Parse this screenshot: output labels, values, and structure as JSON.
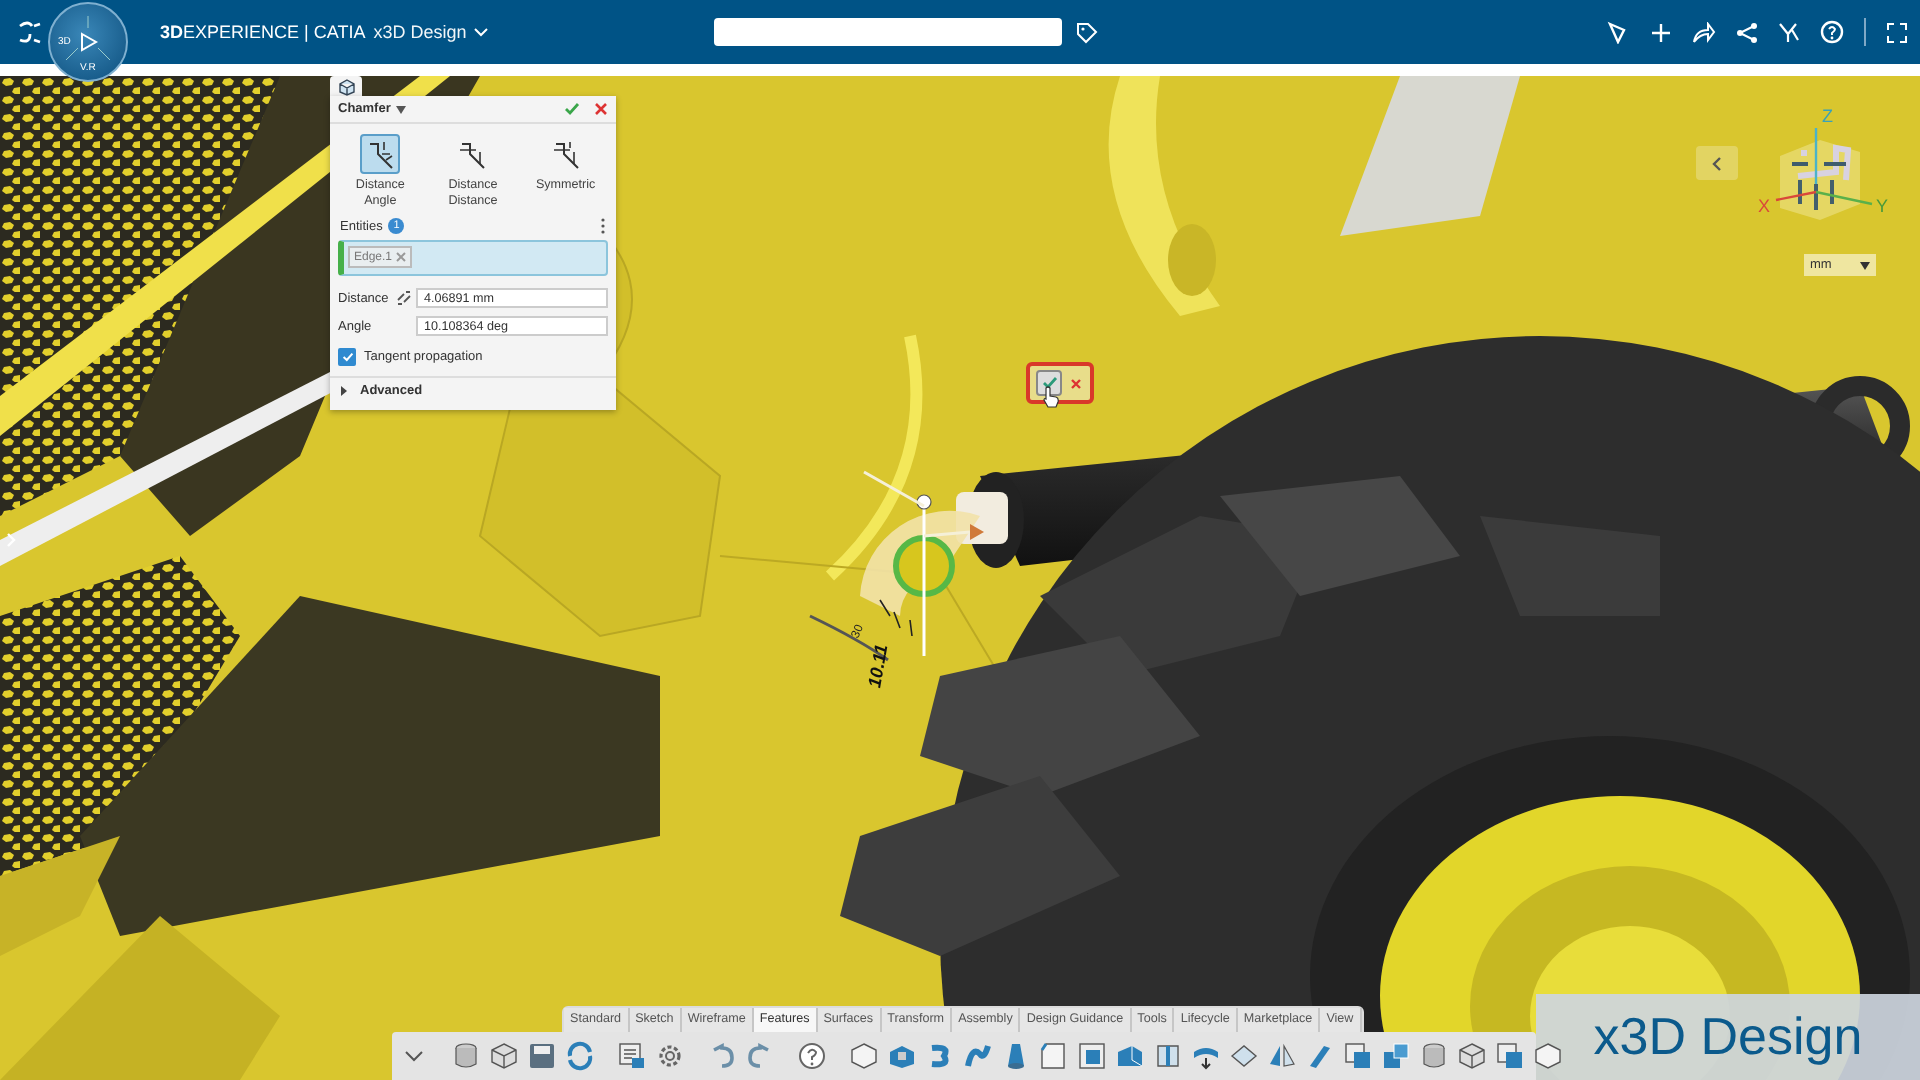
{
  "top_bar": {
    "brand": "**3D**EXPERIENCE | CATIA",
    "role": "x3D Design",
    "compass_labels": [
      "3D",
      "V.R"
    ]
  },
  "chamfer_panel": {
    "title": "Chamfer",
    "modes": [
      {
        "label": "Distance Angle",
        "selected": true
      },
      {
        "label": "Distance Distance",
        "selected": false
      },
      {
        "label": "Symmetric",
        "selected": false
      }
    ],
    "entities": {
      "label": "Entities",
      "count": "1",
      "items": [
        "Edge.1"
      ]
    },
    "fields": [
      {
        "label": "Distance",
        "value": "4.06891 mm",
        "kind": "linked"
      },
      {
        "label": "Angle",
        "value": "10.108364 deg",
        "kind": "plain"
      }
    ],
    "tangent_propagation": {
      "label": "Tangent propagation",
      "checked": true
    },
    "advanced": {
      "label": "Advanced",
      "expanded": false
    }
  },
  "viewport": {
    "dimension_label": "10.11",
    "scale_label": "30",
    "axes": [
      "X",
      "Y",
      "Z"
    ],
    "units": "mm"
  },
  "toolbar": {
    "tabs": [
      {
        "label": "Standard",
        "selected": false
      },
      {
        "label": "Sketch",
        "selected": false
      },
      {
        "label": "Wireframe",
        "selected": false
      },
      {
        "label": "Features",
        "selected": true
      },
      {
        "label": "Surfaces",
        "selected": false
      },
      {
        "label": "Transform",
        "selected": false
      },
      {
        "label": "Assembly",
        "selected": false
      },
      {
        "label": "Design Guidance",
        "selected": false
      },
      {
        "label": "Tools",
        "selected": false
      },
      {
        "label": "Lifecycle",
        "selected": false
      },
      {
        "label": "Marketplace",
        "selected": false
      },
      {
        "label": "View",
        "selected": false
      }
    ]
  },
  "app_badge": "x3D Design"
}
